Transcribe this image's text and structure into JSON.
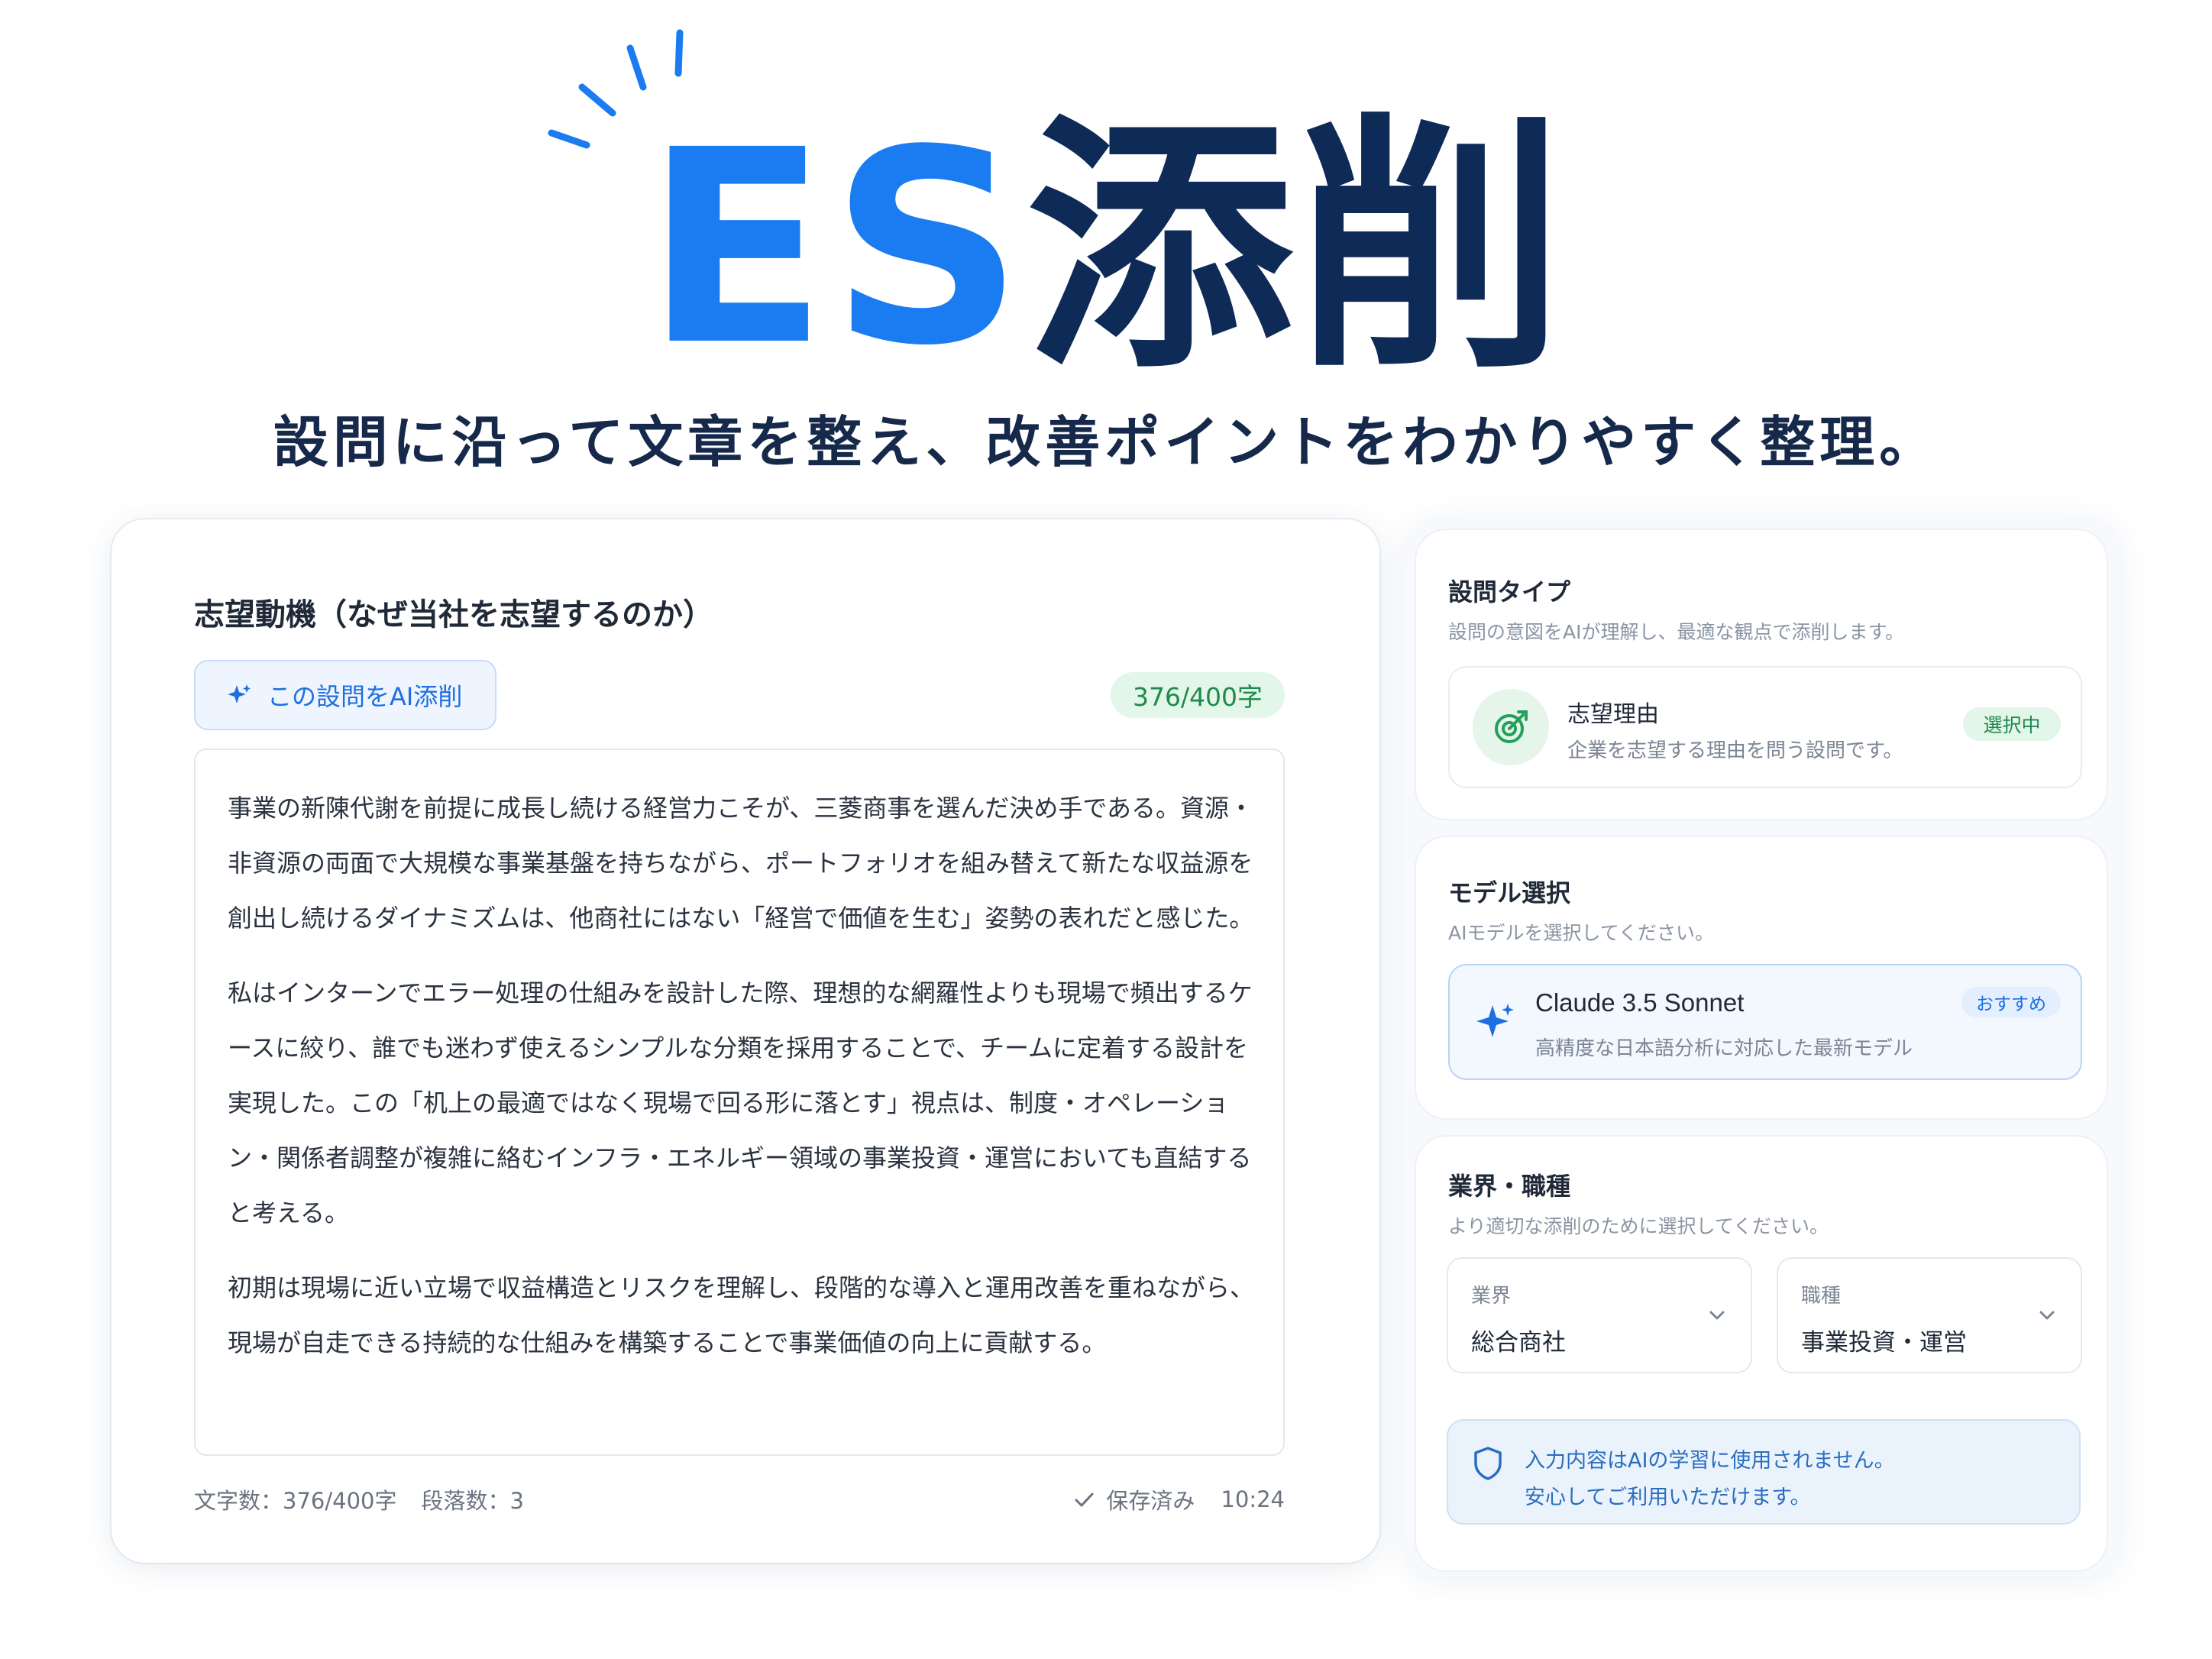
{
  "hero": {
    "title_es": "ES",
    "title_jp": "添削",
    "subtitle": "設問に沿って文章を整え、改善ポイントをわかりやすく整理。"
  },
  "editor": {
    "question_title": "志望動機（なぜ当社を志望するのか）",
    "ai_button_label": "この設問をAI添削",
    "char_badge": "376/400字",
    "paragraphs": [
      "事業の新陳代謝を前提に成長し続ける経営力こそが、三菱商事を選んだ決め手である。資源・非資源の両面で大規模な事業基盤を持ちながら、ポートフォリオを組み替えて新たな収益源を創出し続けるダイナミズムは、他商社にはない「経営で価値を生む」姿勢の表れだと感じた。",
      "私はインターンでエラー処理の仕組みを設計した際、理想的な網羅性よりも現場で頻出するケースに絞り、誰でも迷わず使えるシンプルな分類を採用することで、チームに定着する設計を実現した。この「机上の最適ではなく現場で回る形に落とす」視点は、制度・オペレーション・関係者調整が複雑に絡むインフラ・エネルギー領域の事業投資・運営においても直結すると考える。",
      "初期は現場に近い立場で収益構造とリスクを理解し、段階的な導入と運用改善を重ねながら、現場が自走できる持続的な仕組みを構築することで事業価値の向上に貢献する。"
    ],
    "footer": {
      "char_count": "文字数：376/400字",
      "paragraph_count": "段落数：3",
      "saved": "保存済み",
      "time": "10:24"
    }
  },
  "question_type": {
    "title": "設問タイプ",
    "description": "設問の意図をAIが理解し、最適な観点で添削します。",
    "option_name": "志望理由",
    "option_desc": "企業を志望する理由を問う設問です。",
    "option_tag": "選択中"
  },
  "model": {
    "title": "モデル選択",
    "description": "AIモデルを選択してください。",
    "option_name": "Claude 3.5 Sonnet",
    "option_desc": "高精度な日本語分析に対応した最新モデル",
    "option_tag": "おすすめ"
  },
  "industry": {
    "title": "業界・職種",
    "description": "より適切な添削のために選択してください。",
    "industry_label": "業界",
    "industry_value": "総合商社",
    "job_label": "職種",
    "job_value": "事業投資・運営",
    "notice_line1": "入力内容はAIの学習に使用されません。",
    "notice_line2": "安心してご利用いただけます。"
  },
  "colors": {
    "accent_blue": "#1a7cf0",
    "navy": "#0e2a56",
    "green": "#1f8a4c"
  },
  "icons": [
    "sparkle-icon",
    "target-icon",
    "star-sparkle-icon",
    "chevron-down-icon",
    "check-icon",
    "shield-icon"
  ]
}
